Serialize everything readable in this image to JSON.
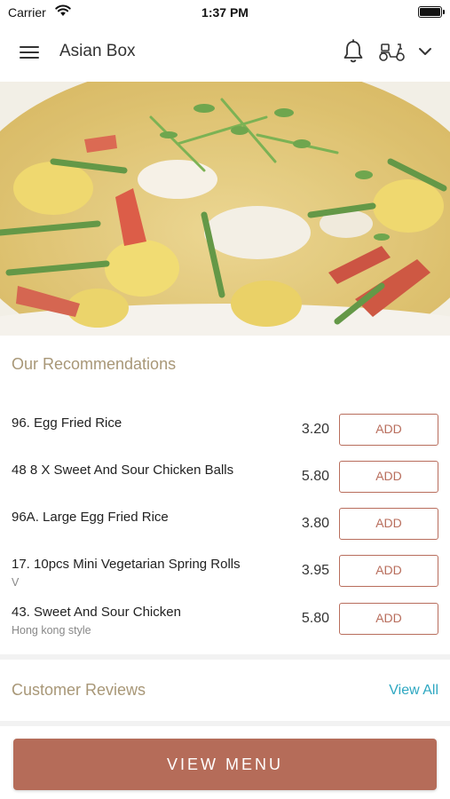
{
  "status_bar": {
    "carrier": "Carrier",
    "time": "1:37 PM"
  },
  "header": {
    "title": "Asian Box"
  },
  "icons": {
    "menu": "hamburger-menu-icon",
    "notifications": "bell-icon",
    "delivery": "moped-icon",
    "dropdown": "chevron-down-icon"
  },
  "colors": {
    "accent": "#b56c59",
    "section_title": "#a89777",
    "link": "#2da7c1"
  },
  "recommendations": {
    "title": "Our Recommendations",
    "items": [
      {
        "name": "96. Egg Fried Rice",
        "subtitle": "",
        "price": "3.20",
        "button": "ADD"
      },
      {
        "name": "48 8 X Sweet And Sour Chicken Balls",
        "subtitle": "",
        "price": "5.80",
        "button": "ADD"
      },
      {
        "name": "96A. Large Egg Fried Rice",
        "subtitle": "",
        "price": "3.80",
        "button": "ADD"
      },
      {
        "name": "17. 10pcs Mini Vegetarian Spring Rolls",
        "subtitle": "V",
        "price": "3.95",
        "button": "ADD"
      },
      {
        "name": "43. Sweet And Sour Chicken",
        "subtitle": "Hong kong style",
        "price": "5.80",
        "button": "ADD"
      }
    ]
  },
  "reviews": {
    "title": "Customer Reviews",
    "view_all": "View All"
  },
  "footer": {
    "button": "VIEW MENU"
  }
}
